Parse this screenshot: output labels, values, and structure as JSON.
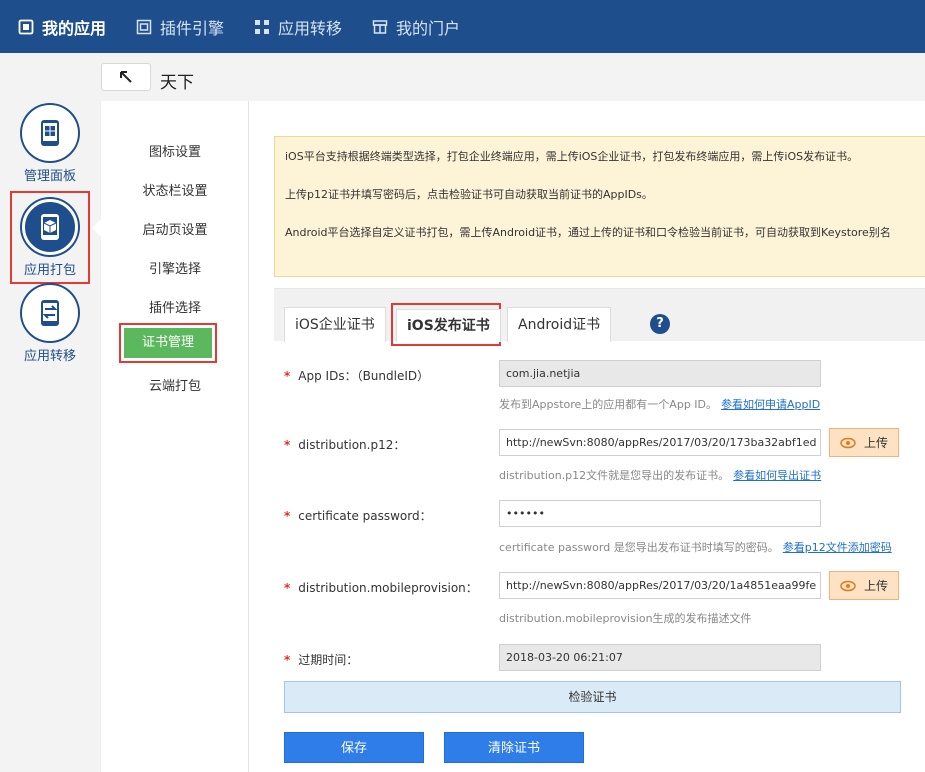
{
  "topnav": {
    "items": [
      {
        "label": "我的应用",
        "icon": "app-box-icon"
      },
      {
        "label": "插件引擎",
        "icon": "plugin-icon"
      },
      {
        "label": "应用转移",
        "icon": "transfer-icon"
      },
      {
        "label": "我的门户",
        "icon": "portal-icon"
      }
    ]
  },
  "header": {
    "app_name": "天下"
  },
  "rail": {
    "items": [
      {
        "label": "管理面板",
        "icon": "phone-dashboard-icon"
      },
      {
        "label": "应用打包",
        "icon": "phone-package-icon"
      },
      {
        "label": "应用转移",
        "icon": "phone-transfer-icon"
      }
    ]
  },
  "submenu": {
    "items": [
      "图标设置",
      "状态栏设置",
      "启动页设置",
      "引擎选择",
      "插件选择",
      "证书管理",
      "云端打包"
    ]
  },
  "notice": {
    "line1": "iOS平台支持根据终端类型选择，打包企业终端应用，需上传iOS企业证书，打包发布终端应用，需上传iOS发布证书。",
    "line2": "上传p12证书并填写密码后，点击检验证书可自动获取当前证书的AppIDs。",
    "line3": "Android平台选择自定义证书打包，需上传Android证书，通过上传的证书和口令检验当前证书，可自动获取到Keystore别名"
  },
  "tabs": {
    "items": [
      "iOS企业证书",
      "iOS发布证书",
      "Android证书"
    ],
    "help": "?"
  },
  "form": {
    "required_mark": "*",
    "appids": {
      "label": "App IDs：（BundleID）",
      "value": "com.jia.netjia",
      "hint": "发布到Appstore上的应用都有一个App ID。",
      "link": "参看如何申请AppID"
    },
    "p12": {
      "label": "distribution.p12：",
      "value": "http://newSvn:8080/appRes/2017/03/20/173ba32abf1ed",
      "upload": "上传",
      "hint": "distribution.p12文件就是您导出的发布证书。",
      "link": "参看如何导出证书"
    },
    "password": {
      "label": "certificate password：",
      "value": "••••••",
      "hint": "certificate password 是您导出发布证书时填写的密码。",
      "link": "参看p12文件添加密码"
    },
    "mobileprovision": {
      "label": "distribution.mobileprovision：",
      "value": "http://newSvn:8080/appRes/2017/03/20/1a4851eaa99fe",
      "upload": "上传",
      "hint": "distribution.mobileprovision生成的发布描述文件"
    },
    "expiry": {
      "label": "过期时间：",
      "value": "2018-03-20 06:21:07"
    }
  },
  "actions": {
    "verify": "检验证书",
    "save": "保存",
    "clear": "清除证书"
  },
  "colors": {
    "nav": "#1f4e8c",
    "accent": "#2e7de8",
    "highlight": "#e53935",
    "active_green": "#5cb85c",
    "notice_bg": "#fdf3d6"
  }
}
